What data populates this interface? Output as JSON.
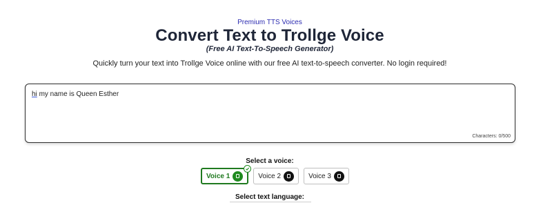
{
  "header": {
    "premium_link": "Premium TTS Voices",
    "title": "Convert Text to Trollge Voice",
    "subtitle": "(Free AI Text-To-Speech Generator)",
    "description": "Quickly turn your text into Trollge Voice online with our free AI text-to-speech converter. No login required!"
  },
  "editor": {
    "text_first_word": "hi",
    "text_rest": " my name is Queen Esther",
    "char_count": "Characters: 0/500"
  },
  "voice_select": {
    "label": "Select a voice:",
    "voices": [
      {
        "label": "Voice 1",
        "selected": true
      },
      {
        "label": "Voice 2",
        "selected": false
      },
      {
        "label": "Voice 3",
        "selected": false
      }
    ]
  },
  "language_select": {
    "label": "Select text language:"
  },
  "colors": {
    "selected_accent": "#1f7a1f",
    "link": "#2b2bb0",
    "title": "#1e2537"
  }
}
